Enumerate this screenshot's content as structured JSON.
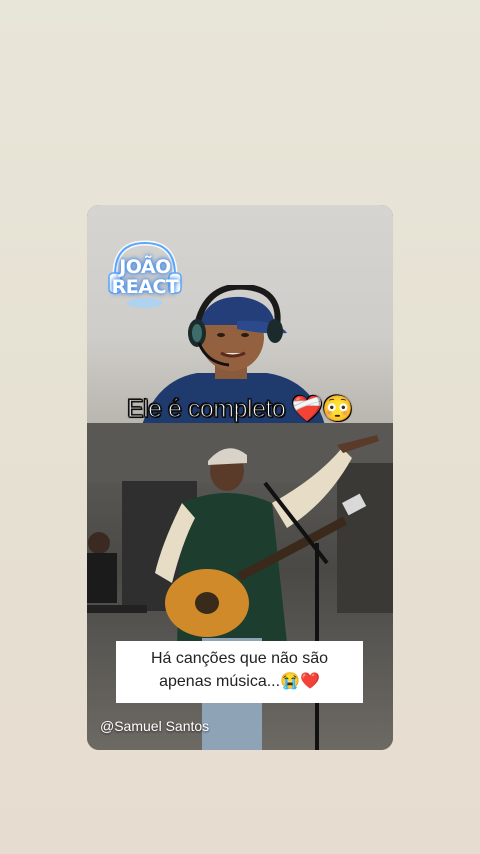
{
  "story": {
    "watermark": "JOÃO REACT",
    "overlay_title": "Ele é completo ❤️‍🩹😳",
    "caption_line1": "Há canções que não são",
    "caption_line2": "apenas música...😭❤️",
    "handle": "@Samuel Santos"
  },
  "colors": {
    "background": "#e7e3d6",
    "caption_bg": "#ffffff",
    "text_light": "#ffffff"
  }
}
